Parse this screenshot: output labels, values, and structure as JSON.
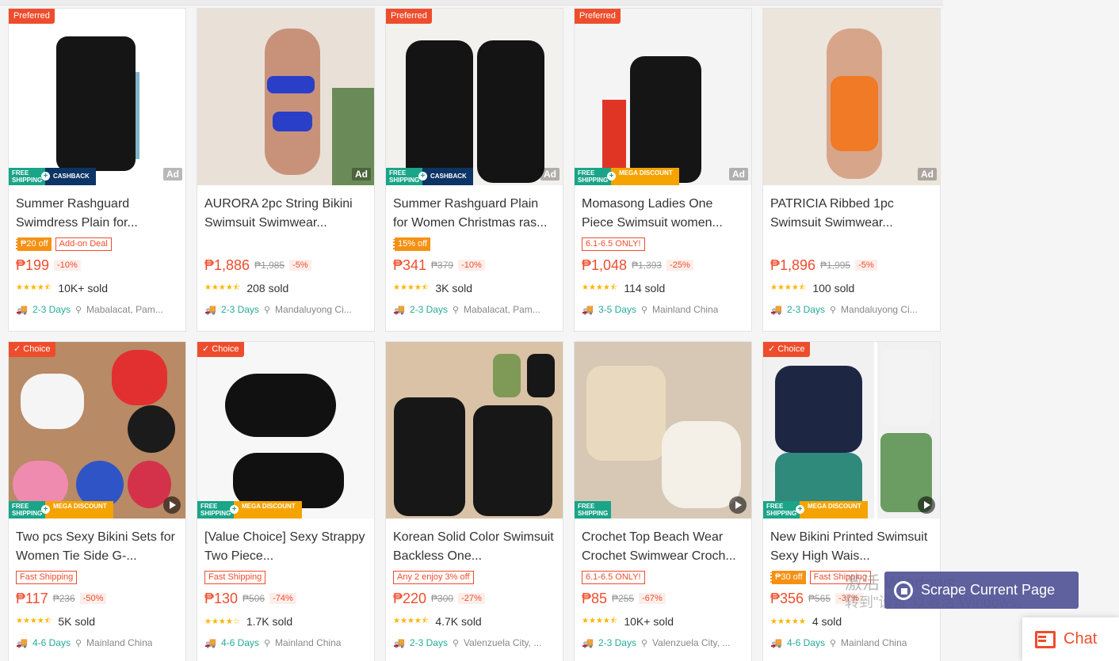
{
  "colors": {
    "brand": "#ee4d2d",
    "teal": "#26aa99",
    "star": "#ffb400"
  },
  "products": [
    {
      "title": "Summer Rashguard Swimdress Plain for...",
      "top_tag": "Preferred",
      "ad": "Ad",
      "video": false,
      "badges": [
        "FREE SHIPPING",
        "CASHBACK"
      ],
      "promos": [
        {
          "text": "₱20 off",
          "style": "solid"
        },
        {
          "text": "Add-on Deal",
          "style": "outline"
        }
      ],
      "price": "₱199",
      "original": "",
      "discount": "-10%",
      "rating": 4.5,
      "sold": "10K+ sold",
      "days": "2-3 Days",
      "location": "Mabalacat, Pam..."
    },
    {
      "title": "AURORA 2pc String Bikini Swimsuit Swimwear...",
      "top_tag": "",
      "ad": "Ad",
      "video": false,
      "badges": [],
      "promos": [],
      "price": "₱1,886",
      "original": "₱1,985",
      "discount": "-5%",
      "rating": 4.5,
      "sold": "208 sold",
      "days": "2-3 Days",
      "location": "Mandaluyong Ci..."
    },
    {
      "title": "Summer Rashguard Plain for Women Christmas ras...",
      "top_tag": "Preferred",
      "ad": "Ad",
      "video": false,
      "badges": [
        "FREE SHIPPING",
        "CASHBACK"
      ],
      "promos": [
        {
          "text": "15% off",
          "style": "solid"
        }
      ],
      "price": "₱341",
      "original": "₱379",
      "discount": "-10%",
      "rating": 4.5,
      "sold": "3K sold",
      "days": "2-3 Days",
      "location": "Mabalacat, Pam..."
    },
    {
      "title": "Momasong Ladies One Piece Swimsuit women...",
      "top_tag": "Preferred",
      "ad": "Ad",
      "video": false,
      "badges": [
        "FREE SHIPPING",
        "MEGA DISCOUNT"
      ],
      "promos": [
        {
          "text": "6.1-6.5 ONLY!",
          "style": "outline"
        }
      ],
      "price": "₱1,048",
      "original": "₱1,393",
      "discount": "-25%",
      "rating": 4.5,
      "sold": "114 sold",
      "days": "3-5 Days",
      "location": "Mainland China"
    },
    {
      "title": "PATRICIA Ribbed 1pc Swimsuit Swimwear...",
      "top_tag": "",
      "ad": "Ad",
      "video": false,
      "badges": [],
      "promos": [],
      "price": "₱1,896",
      "original": "₱1,995",
      "discount": "-5%",
      "rating": 4.5,
      "sold": "100 sold",
      "days": "2-3 Days",
      "location": "Mandaluyong Ci..."
    },
    {
      "title": "Two pcs Sexy Bikini Sets for Women Tie Side G-...",
      "top_tag": "✓ Choice",
      "ad": "",
      "video": true,
      "badges": [
        "FREE SHIPPING",
        "MEGA DISCOUNT"
      ],
      "promos": [
        {
          "text": "Fast Shipping",
          "style": "outline"
        }
      ],
      "price": "₱117",
      "original": "₱236",
      "discount": "-50%",
      "rating": 4.5,
      "sold": "5K sold",
      "days": "4-6 Days",
      "location": "Mainland China"
    },
    {
      "title": "[Value Choice] Sexy Strappy Two Piece...",
      "top_tag": "✓ Choice",
      "ad": "",
      "video": false,
      "badges": [
        "FREE SHIPPING",
        "MEGA DISCOUNT"
      ],
      "promos": [
        {
          "text": "Fast Shipping",
          "style": "outline"
        }
      ],
      "price": "₱130",
      "original": "₱506",
      "discount": "-74%",
      "rating": 4,
      "sold": "1.7K sold",
      "days": "4-6 Days",
      "location": "Mainland China"
    },
    {
      "title": "Korean Solid Color Swimsuit Backless One...",
      "top_tag": "",
      "ad": "",
      "video": false,
      "badges": [],
      "promos": [
        {
          "text": "Any 2 enjoy 3% off",
          "style": "outline"
        }
      ],
      "price": "₱220",
      "original": "₱300",
      "discount": "-27%",
      "rating": 4.5,
      "sold": "4.7K sold",
      "days": "2-3 Days",
      "location": "Valenzuela City, ..."
    },
    {
      "title": "Crochet Top Beach Wear Crochet Swimwear Croch...",
      "top_tag": "",
      "ad": "",
      "video": true,
      "badges": [
        "FREE SHIPPING"
      ],
      "promos": [
        {
          "text": "6.1-6.5 ONLY!",
          "style": "outline"
        }
      ],
      "price": "₱85",
      "original": "₱255",
      "discount": "-67%",
      "rating": 4.5,
      "sold": "10K+ sold",
      "days": "2-3 Days",
      "location": "Valenzuela City, ..."
    },
    {
      "title": "New Bikini Printed Swimsuit Sexy High Wais...",
      "top_tag": "✓ Choice",
      "ad": "",
      "video": true,
      "badges": [
        "FREE SHIPPING",
        "MEGA DISCOUNT"
      ],
      "promos": [
        {
          "text": "₱30 off",
          "style": "solid"
        },
        {
          "text": "Fast Shipping",
          "style": "outline"
        }
      ],
      "price": "₱356",
      "original": "₱565",
      "discount": "-37%",
      "rating": 5,
      "sold": "4 sold",
      "days": "4-6 Days",
      "location": "Mainland China"
    }
  ],
  "overlay": {
    "watermark_line1": "激活 Windows",
    "watermark_line2": "转到\"设置\"以激活 Windows。",
    "scrape_label": "Scrape Current Page",
    "chat_label": "Chat"
  }
}
